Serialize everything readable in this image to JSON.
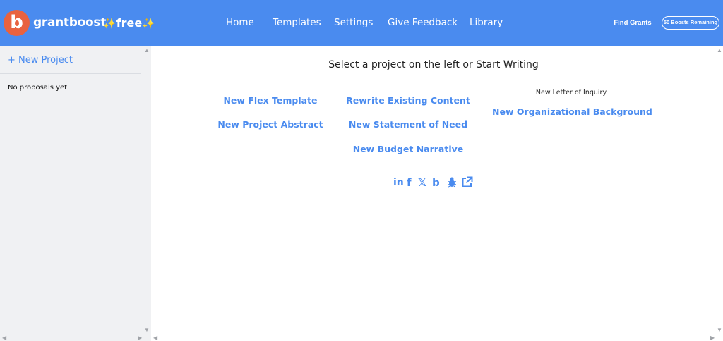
{
  "header": {
    "logo_letter": "b",
    "brand": "grantboost",
    "plan_label": "free",
    "sparkle": "✨",
    "nav": [
      {
        "label": "Home"
      },
      {
        "label": "Templates"
      },
      {
        "label": "Settings"
      },
      {
        "label": "Give Feedback"
      },
      {
        "label": "Library"
      }
    ],
    "find_grants": "Find Grants",
    "boosts_remaining": "50 Boosts Remaining"
  },
  "sidebar": {
    "new_project": "+ New Project",
    "empty_message": "No proposals yet"
  },
  "main": {
    "prompt": "Select a project on the left or Start Writing",
    "templates": {
      "flex": "New Flex Template",
      "rewrite": "Rewrite Existing Content",
      "abstract": "New Project Abstract",
      "need": "New Statement of Need",
      "budget": "New Budget Narrative",
      "loi": "New Letter of Inquiry",
      "org_background": "New Organizational Background"
    },
    "socials": [
      "linkedin-icon",
      "facebook-icon",
      "x-icon",
      "blog-icon",
      "bug-icon",
      "external-link-icon"
    ]
  },
  "colors": {
    "header_bg": "#4a8bef",
    "accent": "#4a8bef",
    "logo_bg": "#e8623f",
    "sidebar_bg": "#f0f1f3"
  }
}
